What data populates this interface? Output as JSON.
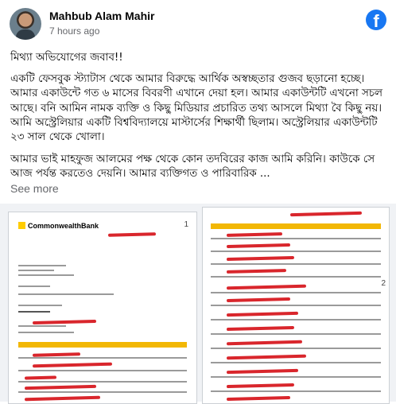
{
  "post": {
    "author": "Mahbub Alam Mahir",
    "time": "7 hours ago",
    "icons": {
      "facebook": "facebook-logo-icon"
    },
    "paragraphs": [
      "মিথ্যা অভিযোগের জবাব!!",
      "একটি ফেসবুক স্ট্যাটাস থেকে আমার বিরুদ্ধে আর্থিক অস্বচ্ছতার গুজব ছড়ানো হচ্ছে। আমার একাউন্টে গত ৬ মাসের বিবরণী এখানে দেয়া হল। আমার একাউন্টটি এখনো সচল আছে। বনি আমিন নামক ব্যক্তি ও কিছু মিডিয়ার প্রচারিত তথ্য আসলে মিথ্যা বৈ কিছু নয়। আমি অস্ট্রেলিয়ার একটি বিশ্ববিদ্যালয়ে মাস্টার্সের শিক্ষার্থী ছিলাম। অস্ট্রেলিয়ার একাউন্টটি ২৩ সাল থেকে খোলা।",
      "আমার ভাই মাহফুজ আলমের পক্ষ থেকে কোন তদবিরের কাজ আমি করিনি। কাউকে সে আজ পর্যন্ত করতেও দেয়নি। আমার ব্যক্তিগত ও পারিবারিক ..."
    ],
    "see_more": "See more"
  },
  "photos": {
    "doc1": {
      "bank": "CommonwealthBank",
      "number": "1"
    },
    "doc2": {
      "number": "2"
    }
  }
}
